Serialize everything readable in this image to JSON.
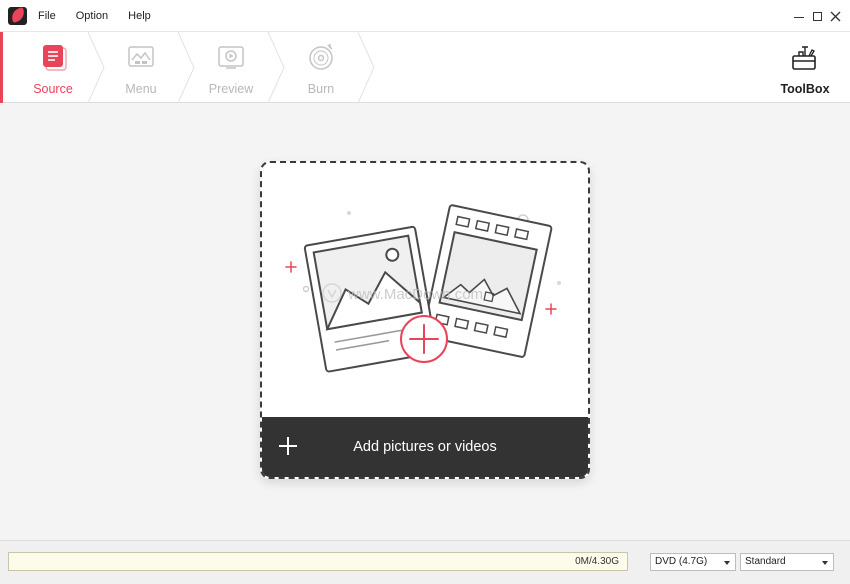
{
  "menu": {
    "file": "File",
    "option": "Option",
    "help": "Help"
  },
  "steps": [
    {
      "label": "Source",
      "icon": "source-icon",
      "active": true
    },
    {
      "label": "Menu",
      "icon": "menu-template-icon",
      "active": false
    },
    {
      "label": "Preview",
      "icon": "preview-icon",
      "active": false
    },
    {
      "label": "Burn",
      "icon": "burn-disc-icon",
      "active": false
    }
  ],
  "toolbox": {
    "label": "ToolBox",
    "icon": "toolbox-icon"
  },
  "dropzone": {
    "add_label": "Add pictures or videos",
    "watermark": "www.MacDown.com"
  },
  "status": {
    "capacity_text": "0M/4.30G",
    "capacity_used_fraction": 0,
    "disc_type": "DVD (4.7G)",
    "quality": "Standard"
  },
  "colors": {
    "accent": "#e8455a",
    "inactive": "#b8b8b8",
    "addbar": "#333333"
  }
}
